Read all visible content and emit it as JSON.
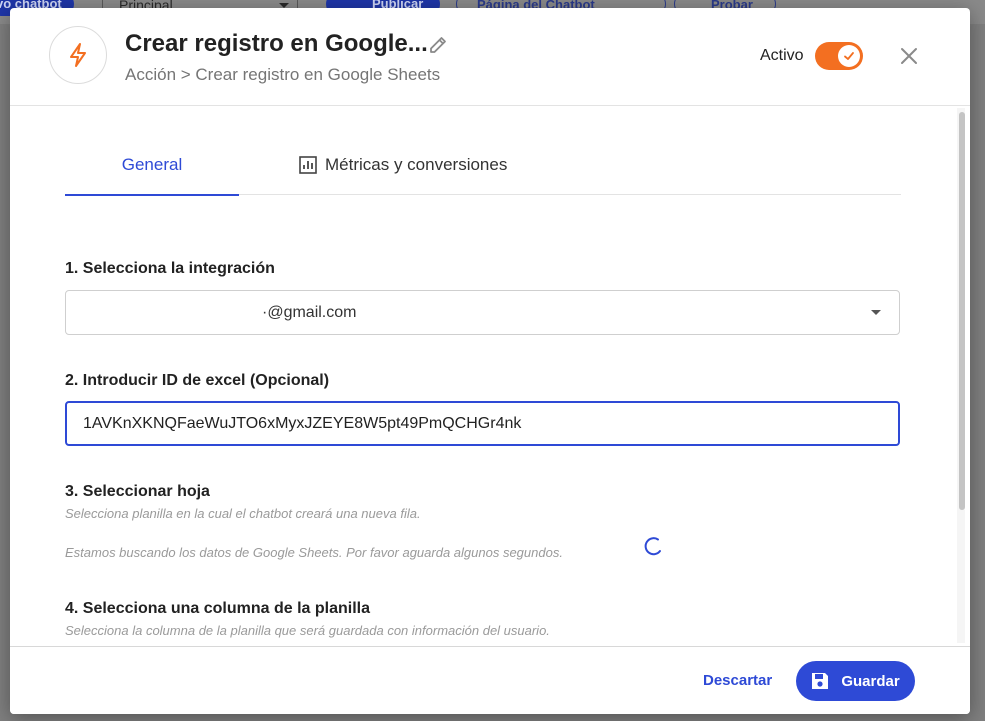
{
  "background": {
    "chatbot_chip": "vo chatbot",
    "principal_select": "Principal",
    "publicar_button": "Publicar",
    "pagina_button": "Página del Chatbot",
    "probar_button": "Probar"
  },
  "modal": {
    "title": "Crear registro en Google...",
    "breadcrumb": "Acción > Crear registro en Google Sheets",
    "active_label": "Activo",
    "active": true,
    "icons": {
      "header": "lightning-bolt-icon",
      "edit": "pencil-icon",
      "close": "close-icon",
      "tab_metricas": "bar-chart-icon",
      "save": "floppy-disk-icon"
    },
    "colors": {
      "accent": "#2e4ad6",
      "toggle": "#f36f21"
    }
  },
  "tabs": [
    {
      "label": "General",
      "active": true
    },
    {
      "label": "Métricas y conversiones",
      "active": false
    }
  ],
  "sections": {
    "integration": {
      "label": "1. Selecciona la integración",
      "selected_value": "·@gmail.com"
    },
    "excel_id": {
      "label": "2. Introducir ID de excel (Opcional)",
      "value": "1AVKnXKNQFaeWuJTO6xMyxJZEYE8W5pt49PmQCHGr4nk"
    },
    "sheet": {
      "label": "3. Seleccionar hoja",
      "help": "Selecciona planilla en la cual el chatbot creará una nueva fila.",
      "loading_text": "Estamos buscando los datos de Google Sheets. Por favor aguarda algunos segundos."
    },
    "column": {
      "label": "4. Selecciona una columna de la planilla",
      "help": "Selecciona la columna de la planilla que será guardada con información del usuario."
    }
  },
  "footer": {
    "discard_label": "Descartar",
    "save_label": "Guardar"
  }
}
